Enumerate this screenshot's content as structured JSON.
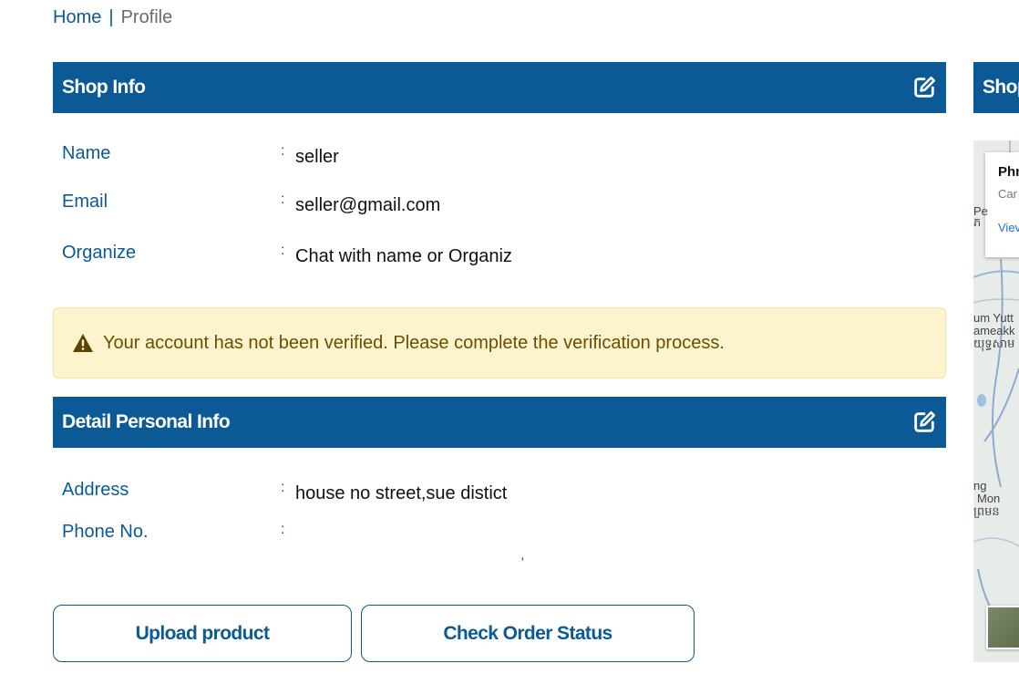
{
  "breadcrumb": {
    "home": "Home",
    "separator": "|",
    "current": "Profile"
  },
  "shop_info": {
    "title": "Shop Info",
    "edit_icon": "edit-icon",
    "rows": [
      {
        "label": "Name",
        "colon": ":",
        "value": "seller"
      },
      {
        "label": "Email",
        "colon": ":",
        "value": "seller@gmail.com"
      },
      {
        "label": "Organize",
        "colon": ":",
        "value": "Chat with name or Organiz"
      }
    ]
  },
  "alert": {
    "icon": "warning-icon",
    "message": "Your account has not been verified. Please complete the verification process."
  },
  "personal_info": {
    "title": "Detail Personal Info",
    "edit_icon": "edit-icon",
    "rows": [
      {
        "label": "Address",
        "colon": ":",
        "value": "house no street,sue distict"
      },
      {
        "label": "Phone No.",
        "colon": ":",
        "value": ""
      }
    ],
    "stray_mark": ","
  },
  "actions": {
    "upload_label": "Upload product",
    "check_order_label": "Check Order Status"
  },
  "side_panel": {
    "title": "Shop",
    "map_card": {
      "place": "Phn",
      "country": "Car",
      "view_link": "Viev"
    },
    "map_labels": [
      "Pe",
      "ភ",
      "um Yutt",
      "ameakk",
      "យុទ្ធសាម",
      "ng",
      "Mon",
      "ព្រមន"
    ]
  },
  "colors": {
    "primary": "#0b5a95",
    "alert_bg": "#fdf3cd",
    "alert_text": "#6b4f00"
  }
}
